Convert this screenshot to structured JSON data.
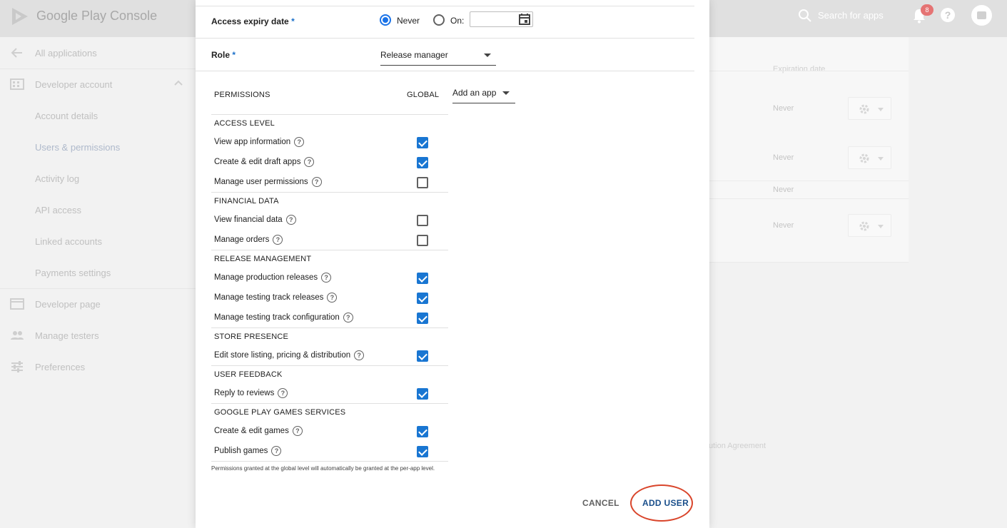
{
  "app": {
    "title": "Google Play Console",
    "search_placeholder": "Search for apps",
    "notification_count": "8",
    "help_glyph": "?"
  },
  "sidebar": {
    "items": [
      {
        "label": "All applications",
        "icon": "arrow-back-icon"
      },
      {
        "label": "Developer account",
        "icon": "business-icon"
      },
      {
        "label": "Account details"
      },
      {
        "label": "Users & permissions",
        "active": true
      },
      {
        "label": "Activity log"
      },
      {
        "label": "API access"
      },
      {
        "label": "Linked accounts"
      },
      {
        "label": "Payments settings"
      },
      {
        "label": "Developer page",
        "icon": "web-icon"
      },
      {
        "label": "Manage testers",
        "icon": "people-icon"
      },
      {
        "label": "Preferences",
        "icon": "tune-icon"
      }
    ]
  },
  "background_table": {
    "column_header": "Expiration date",
    "rows": [
      {
        "expiry": "Never"
      },
      {
        "expiry": "Never"
      },
      {
        "expiry": "Never"
      },
      {
        "expiry": "Never"
      }
    ],
    "footer_fragment": "ution Agreement"
  },
  "dialog": {
    "access_expiry": {
      "label": "Access expiry date",
      "required_mark": "*",
      "option_never": "Never",
      "option_on": "On:",
      "selected": "Never",
      "date_value": ""
    },
    "role": {
      "label": "Role",
      "required_mark": "*",
      "value": "Release manager"
    },
    "permissions": {
      "header": "PERMISSIONS",
      "global_header": "GLOBAL",
      "add_app_label": "Add an app",
      "groups": [
        {
          "title": "ACCESS LEVEL",
          "items": [
            {
              "label": "View app information",
              "checked": true
            },
            {
              "label": "Create & edit draft apps",
              "checked": true
            },
            {
              "label": "Manage user permissions",
              "checked": false
            }
          ]
        },
        {
          "title": "FINANCIAL DATA",
          "items": [
            {
              "label": "View financial data",
              "checked": false
            },
            {
              "label": "Manage orders",
              "checked": false
            }
          ]
        },
        {
          "title": "RELEASE MANAGEMENT",
          "items": [
            {
              "label": "Manage production releases",
              "checked": true
            },
            {
              "label": "Manage testing track releases",
              "checked": true
            },
            {
              "label": "Manage testing track configuration",
              "checked": true
            }
          ]
        },
        {
          "title": "STORE PRESENCE",
          "items": [
            {
              "label": "Edit store listing, pricing & distribution",
              "checked": true
            }
          ]
        },
        {
          "title": "USER FEEDBACK",
          "items": [
            {
              "label": "Reply to reviews",
              "checked": true
            }
          ]
        },
        {
          "title": "GOOGLE PLAY GAMES SERVICES",
          "items": [
            {
              "label": "Create & edit games",
              "checked": true
            },
            {
              "label": "Publish games",
              "checked": true
            }
          ]
        }
      ],
      "note": "Permissions granted at the global level will automatically be granted at the per-app level."
    },
    "buttons": {
      "cancel": "CANCEL",
      "add_user": "ADD USER"
    }
  },
  "colors": {
    "accent": "#1976d2",
    "highlight_ring": "#d9452b",
    "add_user_text": "#1a4f8b"
  }
}
